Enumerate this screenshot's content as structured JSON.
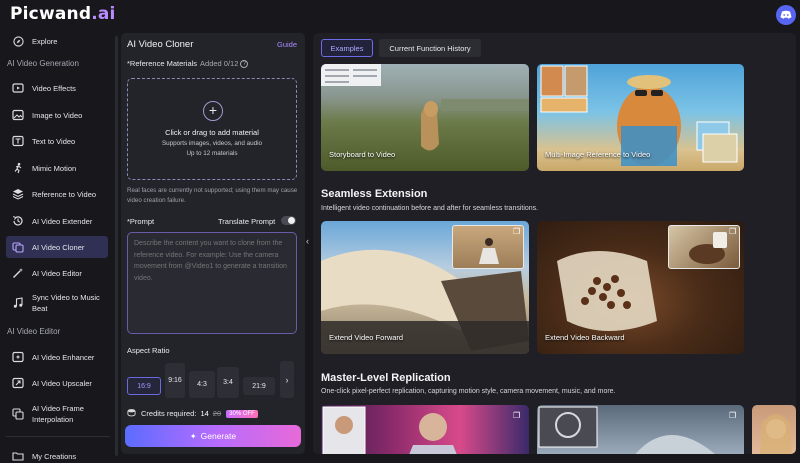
{
  "app": {
    "logo_main": "Picwand",
    "logo_suffix": ".ai"
  },
  "sidebar": {
    "items": [
      {
        "label": "Explore",
        "icon": "compass-icon"
      },
      {
        "label": "Video Effects",
        "icon": "film-effects-icon"
      },
      {
        "label": "Image to Video",
        "icon": "image-icon"
      },
      {
        "label": "Text to Video",
        "icon": "text-icon"
      },
      {
        "label": "Mimic Motion",
        "icon": "person-motion-icon"
      },
      {
        "label": "Reference to Video",
        "icon": "layers-icon"
      },
      {
        "label": "AI Video Extender",
        "icon": "clock-extend-icon"
      },
      {
        "label": "AI Video Cloner",
        "icon": "clone-icon"
      },
      {
        "label": "AI Video Editor",
        "icon": "magic-wand-icon"
      },
      {
        "label": "Sync Video to Music Beat",
        "icon": "music-note-icon"
      },
      {
        "label": "AI Video Enhancer",
        "icon": "enhance-icon"
      },
      {
        "label": "AI Video Upscaler",
        "icon": "upscale-icon"
      },
      {
        "label": "AI Video Frame Interpolation",
        "icon": "frames-icon"
      },
      {
        "label": "My Creations",
        "icon": "folder-icon"
      }
    ],
    "sections": [
      "AI Video Generation",
      "AI Video Editor"
    ],
    "active_index": 7
  },
  "cloner": {
    "title": "AI Video Cloner",
    "guide": "Guide",
    "ref_label": "*Reference Materials",
    "ref_count": "Added 0/12",
    "ref_help": "?",
    "upload_main": "Click or drag to add material",
    "upload_sub1": "Supports images, videos, and audio",
    "upload_sub2": "Up to 12 materials",
    "warning": "Real faces are currently not supported; using them may cause video creation failure.",
    "prompt_label": "*Prompt",
    "translate_label": "Translate Prompt",
    "prompt_placeholder": "Describe the content you want to clone from the reference video. For example: Use the camera movement from @Video1 to generate a transition video.",
    "aspect_label": "Aspect Ratio",
    "ratios": [
      "16:9",
      "9:16",
      "4:3",
      "3:4",
      "21:9"
    ],
    "selected_ratio": "16:9",
    "ratio_next": "›",
    "credits_label": "Credits required:",
    "credits_value": "14",
    "credits_old": "20",
    "credits_discount": "30% OFF",
    "generate_label": "Generate",
    "generate_icon": "sparkle-icon",
    "collapse": "‹"
  },
  "gallery": {
    "tabs": [
      "Examples",
      "Current Function History"
    ],
    "row1": [
      {
        "label": "Storyboard to Video"
      },
      {
        "label": "Multi-Image Reference to Video"
      }
    ],
    "sections": [
      {
        "title": "Seamless Extension",
        "subtitle": "Intelligent video continuation before and after for seamless transitions.",
        "cards": [
          {
            "label": "Extend Video Forward"
          },
          {
            "label": "Extend Video Backward"
          }
        ]
      },
      {
        "title": "Master-Level Replication",
        "subtitle": "One-click pixel-perfect replication, capturing motion style, camera movement, music, and more."
      }
    ]
  },
  "colors": {
    "accent": "#6c6ce8",
    "panel": "#23232a",
    "background": "#17171c"
  }
}
